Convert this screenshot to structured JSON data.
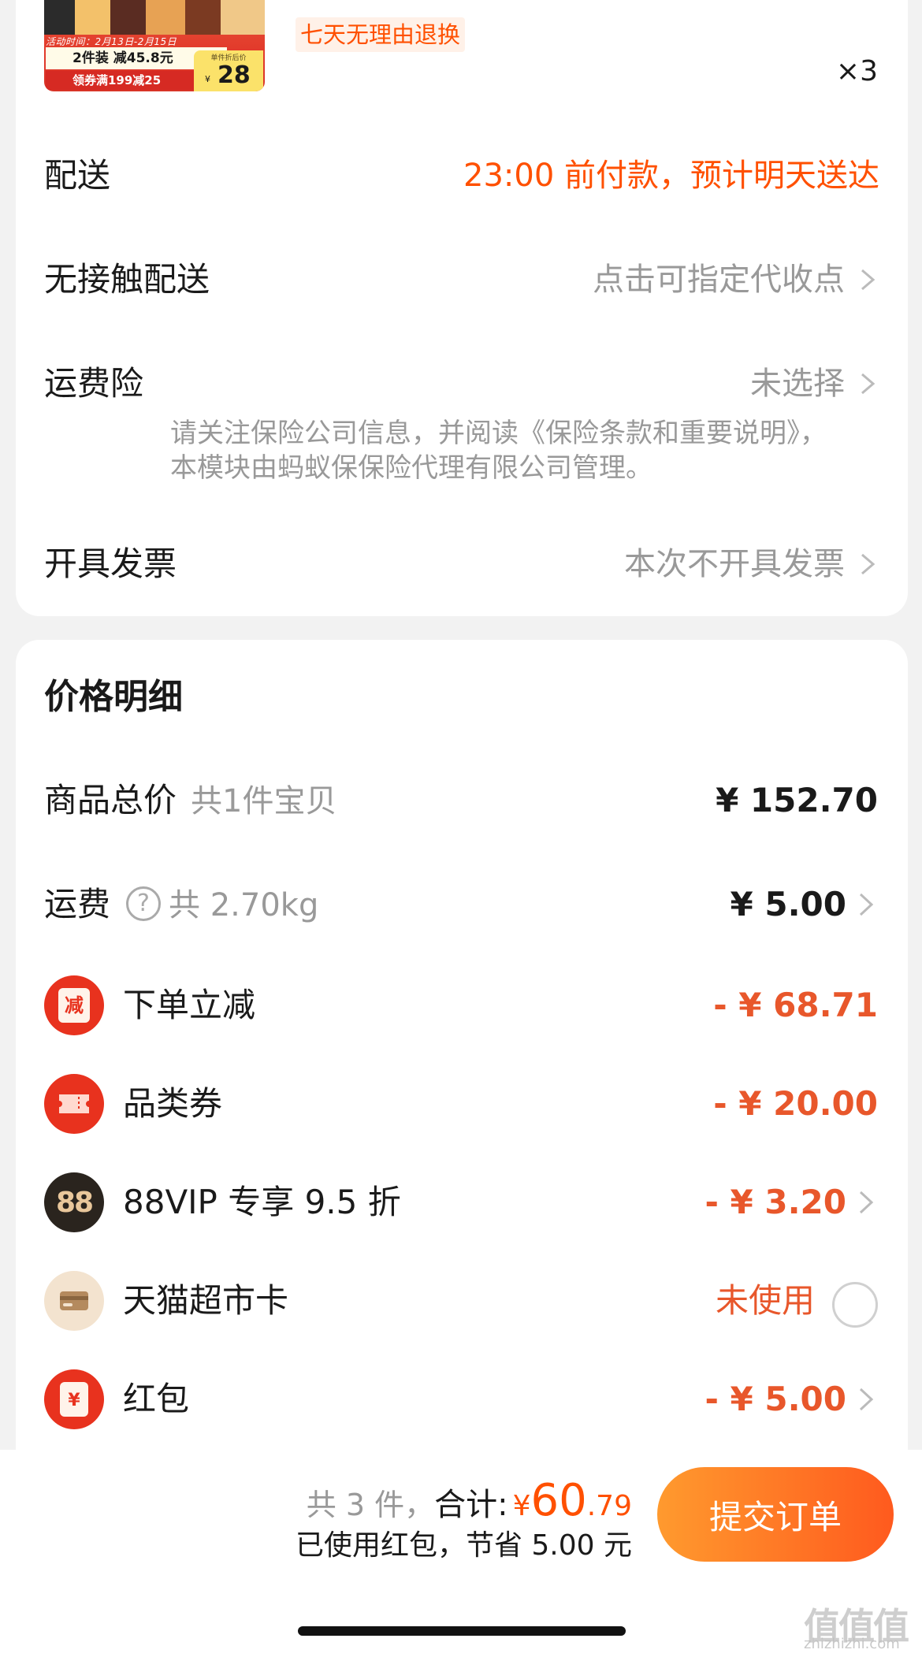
{
  "product": {
    "thumb_promo_time": "活动时间：2月13日-2月15日",
    "thumb_line1": "2件装 减45.8元",
    "thumb_line2": "领券满199减25",
    "thumb_price_label": "单件折后价",
    "thumb_price_currency": "¥",
    "thumb_price": "28",
    "return_policy": "七天无理由退换",
    "quantity": "×3"
  },
  "order_info": {
    "delivery_label": "配送",
    "delivery_value": "23:00 前付款，预计明天送达",
    "contactless_label": "无接触配送",
    "contactless_value": "点击可指定代收点",
    "insurance_label": "运费险",
    "insurance_value": "未选择",
    "insurance_note": "请关注保险公司信息，并阅读《保险条款和重要说明》，本模块由蚂蚁保保险代理有限公司管理。",
    "invoice_label": "开具发票",
    "invoice_value": "本次不开具发票"
  },
  "price_detail": {
    "title": "价格明细",
    "goods_total_label": "商品总价",
    "goods_total_sub": "共1件宝贝",
    "goods_total_amount": "¥ 152.70",
    "shipping_label": "运费",
    "shipping_sub": "共 2.70kg",
    "shipping_amount": "¥ 5.00",
    "order_discount_label": "下单立减",
    "order_discount_amount": "- ¥ 68.71",
    "order_discount_icon_text": "减",
    "category_coupon_label": "品类券",
    "category_coupon_amount": "- ¥ 20.00",
    "vip_label": "88VIP 专享 9.5 折",
    "vip_amount": "- ¥ 3.20",
    "vip_icon_text": "88",
    "tmall_card_label": "天猫超市卡",
    "tmall_card_value": "未使用",
    "red_packet_label": "红包",
    "red_packet_amount": "- ¥ 5.00",
    "red_packet_icon_text": "¥"
  },
  "footer": {
    "count_text": "共 3 件，",
    "total_label": "合计:",
    "currency": "¥",
    "total_int": "60",
    "total_dec": ".79",
    "saving_text": "已使用红包，节省 5.00 元",
    "submit_label": "提交订单",
    "watermark_logo": "值值值",
    "watermark_site": "zhizhizhi.com"
  },
  "colors": {
    "accent": "#ff5000",
    "discount": "#e8572b",
    "button_start": "#ff9a2e",
    "button_end": "#ff5a1e"
  }
}
